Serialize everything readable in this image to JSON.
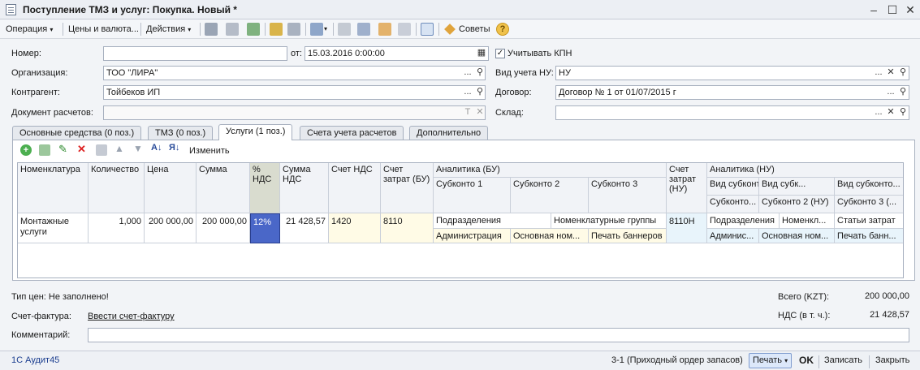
{
  "window": {
    "title": "Поступление ТМЗ и услуг: Покупка. Новый *"
  },
  "toolbar": {
    "operation": "Операция",
    "prices": "Цены и валюта...",
    "actions": "Действия",
    "tips": "Советы"
  },
  "form": {
    "number_label": "Номер:",
    "number_value": "",
    "from_label": "от:",
    "date_value": "15.03.2016  0:00:00",
    "kpn_label": "Учитывать КПН",
    "org_label": "Организация:",
    "org_value": "ТОО \"ЛИРА\"",
    "nu_label": "Вид учета НУ:",
    "nu_value": "НУ",
    "contractor_label": "Контрагент:",
    "contractor_value": "Тойбеков ИП",
    "contract_label": "Договор:",
    "contract_value": "Договор № 1 от 01/07/2015 г",
    "settle_doc_label": "Документ расчетов:",
    "settle_doc_value": "",
    "warehouse_label": "Склад:",
    "warehouse_value": ""
  },
  "tabs": [
    {
      "label": "Основные средства (0 поз.)"
    },
    {
      "label": "ТМЗ (0 поз.)"
    },
    {
      "label": "Услуги (1 поз.)"
    },
    {
      "label": "Счета учета расчетов"
    },
    {
      "label": "Дополнительно"
    }
  ],
  "grid_toolbar": {
    "change": "Изменить"
  },
  "grid": {
    "headers": {
      "nomenclature": "Номенклатура",
      "quantity": "Количество",
      "price": "Цена",
      "sum": "Сумма",
      "vat_pct": "% НДС",
      "vat_sum": "Сумма НДС",
      "vat_account": "Счет НДС",
      "cost_account_bu": "Счет затрат (БУ)",
      "analytics_bu": "Аналитика (БУ)",
      "sub1": "Субконто 1",
      "sub2": "Субконто 2",
      "sub3": "Субконто 3",
      "cost_account_nu": "Счет затрат (НУ)",
      "analytics_nu": "Аналитика (НУ)",
      "nu_kind1": "Вид субконто ...",
      "nu_kind2": "Вид субк...",
      "nu_kind3": "Вид субконто...",
      "nu_sub1": "Субконто...",
      "nu_sub2": "Субконто 2 (НУ)",
      "nu_sub3": "Субконто 3 (..."
    },
    "row": {
      "nomenclature": "Монтажные услуги",
      "quantity": "1,000",
      "price": "200 000,00",
      "sum": "200 000,00",
      "vat_pct": "12%",
      "vat_sum": "21 428,57",
      "vat_account": "1420",
      "cost_account_bu": "8110",
      "bu_kind1": "Подразделения",
      "bu_kind2": "Номенклатурные группы",
      "bu_sub1": "Администрация",
      "bu_sub2": "Основная ном...",
      "bu_sub3": "Печать баннеров",
      "cost_account_nu": "8110Н",
      "nu_kind1": "Подразделения",
      "nu_kind2": "Номенкл...",
      "nu_kind3": "Статьи затрат",
      "nu_sub1": "Админис...",
      "nu_sub2": "Основная ном...",
      "nu_sub3": "Печать банн..."
    }
  },
  "summary": {
    "price_type": "Тип цен: Не заполнено!",
    "total_label": "Всего (KZT):",
    "total_value": "200 000,00",
    "vat_label": "НДС (в т. ч.):",
    "vat_value": "21 428,57",
    "invoice_label": "Счет-фактура:",
    "invoice_link": "Ввести счет-фактуру",
    "comment_label": "Комментарий:",
    "comment_value": ""
  },
  "footer": {
    "app": "1С Аудит45",
    "doc": "3-1 (Приходный ордер запасов)",
    "print": "Печать",
    "ok": "OK",
    "save": "Записать",
    "close": "Закрыть"
  },
  "colors": {
    "accent": "#4a6fd4",
    "vat_cell": "#4a67c8",
    "nu_cell": "#e8f4fb",
    "cost_cell": "#fffbe6"
  }
}
